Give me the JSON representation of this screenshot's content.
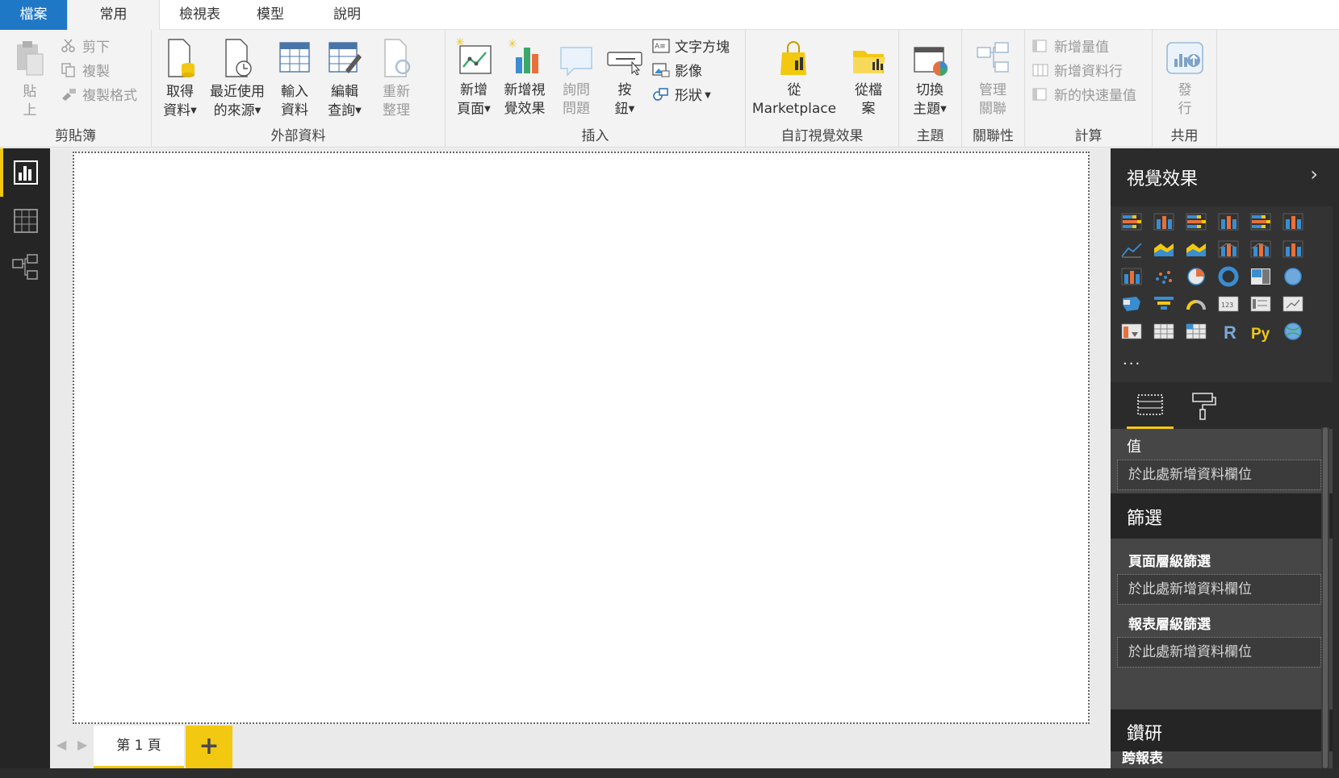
{
  "tabs": {
    "file": "檔案",
    "home": "常用",
    "view": "檢視表",
    "model": "模型",
    "help": "說明"
  },
  "ribbon": {
    "clipboard": {
      "label": "剪貼簿",
      "paste_1": "貼",
      "paste_2": "上",
      "cut": "剪下",
      "copy": "複製",
      "format_painter": "複製格式"
    },
    "external": {
      "label": "外部資料",
      "get_data_1": "取得",
      "get_data_2": "資料",
      "recent_1": "最近使用",
      "recent_2": "的來源",
      "enter_1": "輸入",
      "enter_2": "資料",
      "edit_1": "編輯",
      "edit_2": "查詢",
      "refresh_1": "重新",
      "refresh_2": "整理"
    },
    "insert": {
      "label": "插入",
      "newpage_1": "新增",
      "newpage_2": "頁面",
      "newvisual_1": "新增視",
      "newvisual_2": "覺效果",
      "ask_1": "詢問",
      "ask_2": "問題",
      "button_1": "按",
      "button_2": "鈕",
      "textbox": "文字方塊",
      "image": "影像",
      "shapes": "形狀"
    },
    "custom": {
      "label": "自訂視覺效果",
      "marketplace_1": "從",
      "marketplace_2": "Marketplace",
      "file_1": "從檔",
      "file_2": "案"
    },
    "themes": {
      "label": "主題",
      "switch_1": "切換",
      "switch_2": "主題"
    },
    "relationships": {
      "label": "關聯性",
      "manage_1": "管理",
      "manage_2": "關聯"
    },
    "calculations": {
      "label": "計算",
      "new_measure": "新增量值",
      "new_column": "新增資料行",
      "quick_measure": "新的快速量值"
    },
    "share": {
      "label": "共用",
      "publish_1": "發",
      "publish_2": "行"
    }
  },
  "pages": {
    "page1": "第 1 頁",
    "add": "+"
  },
  "pane": {
    "title": "視覺效果",
    "more": "...",
    "values_label": "值",
    "drop_here": "於此處新增資料欄位",
    "filters_title": "篩選",
    "page_filters": "頁面層級篩選",
    "report_filters": "報表層級篩選",
    "drill_title": "鑽研",
    "cross_report": "跨報表"
  },
  "colors": {
    "accent": "#f2c811",
    "file_tab": "#1f78c6",
    "nav_bg": "#252525",
    "pane_bg": "#333333"
  }
}
